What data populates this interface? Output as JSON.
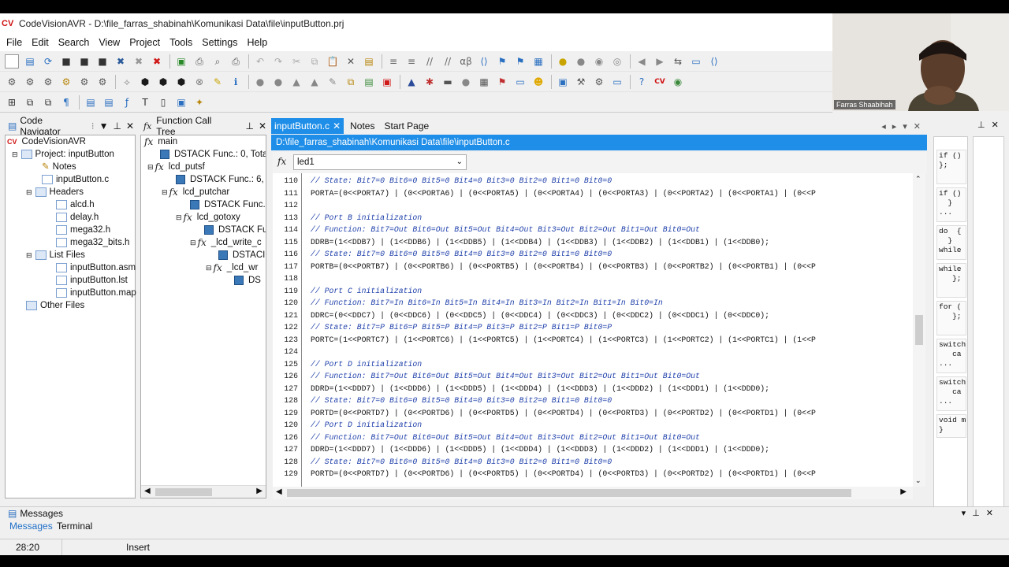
{
  "title": "CodeVisionAVR - D:\\file_farras_shabinah\\Komunikasi Data\\file\\inputButton.prj",
  "app_logo": "CV",
  "menu": [
    "File",
    "Edit",
    "Search",
    "View",
    "Project",
    "Tools",
    "Settings",
    "Help"
  ],
  "panels": {
    "navigator_title": "Code Navigator",
    "calltree_title": "Function Call Tree",
    "messages_title": "Messages",
    "messages_tabs": [
      "Messages",
      "Terminal"
    ]
  },
  "navigator": {
    "root": "CodeVisionAVR",
    "project": "Project: inputButton",
    "notes": "Notes",
    "c_file": "inputButton.c",
    "headers": "Headers",
    "header_files": [
      "alcd.h",
      "delay.h",
      "mega32.h",
      "mega32_bits.h"
    ],
    "list_files": "List Files",
    "list_items": [
      "inputButton.asm",
      "inputButton.lst",
      "inputButton.map"
    ],
    "other_files": "Other Files"
  },
  "calltree": {
    "main": "main",
    "dstack_main": "DSTACK Func.: 0, Tota",
    "lcd_putsf": "lcd_putsf",
    "dstack_putsf": "DSTACK Func.: 6, T",
    "lcd_putchar": "lcd_putchar",
    "dstack_putchar": "DSTACK Func.:",
    "lcd_gotoxy": "lcd_gotoxy",
    "dstack_gotoxy": "DSTACK Fu",
    "lcd_write": "_lcd_write_c",
    "dstack_write": "DSTACI",
    "lcd_wr": "_lcd_wr",
    "dstack_wr": "DS"
  },
  "editor": {
    "tabs": [
      "inputButton.c",
      "Notes",
      "Start Page"
    ],
    "path": "D:\\file_farras_shabinah\\Komunikasi Data\\file\\inputButton.c",
    "function_selector": "led1",
    "lines": [
      {
        "n": "110",
        "t": "// State: Bit7=0 Bit6=0 Bit5=0 Bit4=0 Bit3=0 Bit2=0 Bit1=0 Bit0=0",
        "c": true
      },
      {
        "n": "111",
        "t": "PORTA=(0<<PORTA7) | (0<<PORTA6) | (0<<PORTA5) | (0<<PORTA4) | (0<<PORTA3) | (0<<PORTA2) | (0<<PORTA1) | (0<<P",
        "c": false
      },
      {
        "n": "112",
        "t": "",
        "c": false
      },
      {
        "n": "113",
        "t": "// Port B initialization",
        "c": true
      },
      {
        "n": "114",
        "t": "// Function: Bit7=Out Bit6=Out Bit5=Out Bit4=Out Bit3=Out Bit2=Out Bit1=Out Bit0=Out",
        "c": true
      },
      {
        "n": "115",
        "t": "DDRB=(1<<DDB7) | (1<<DDB6) | (1<<DDB5) | (1<<DDB4) | (1<<DDB3) | (1<<DDB2) | (1<<DDB1) | (1<<DDB0);",
        "c": false
      },
      {
        "n": "116",
        "t": "// State: Bit7=0 Bit6=0 Bit5=0 Bit4=0 Bit3=0 Bit2=0 Bit1=0 Bit0=0",
        "c": true
      },
      {
        "n": "117",
        "t": "PORTB=(0<<PORTB7) | (0<<PORTB6) | (0<<PORTB5) | (0<<PORTB4) | (0<<PORTB3) | (0<<PORTB2) | (0<<PORTB1) | (0<<P",
        "c": false
      },
      {
        "n": "118",
        "t": "",
        "c": false
      },
      {
        "n": "119",
        "t": "// Port C initialization",
        "c": true
      },
      {
        "n": "120",
        "t": "// Function: Bit7=In Bit6=In Bit5=In Bit4=In Bit3=In Bit2=In Bit1=In Bit0=In",
        "c": true
      },
      {
        "n": "121",
        "t": "DDRC=(0<<DDC7) | (0<<DDC6) | (0<<DDC5) | (0<<DDC4) | (0<<DDC3) | (0<<DDC2) | (0<<DDC1) | (0<<DDC0);",
        "c": false
      },
      {
        "n": "122",
        "t": "// State: Bit7=P Bit6=P Bit5=P Bit4=P Bit3=P Bit2=P Bit1=P Bit0=P",
        "c": true
      },
      {
        "n": "123",
        "t": "PORTC=(1<<PORTC7) | (1<<PORTC6) | (1<<PORTC5) | (1<<PORTC4) | (1<<PORTC3) | (1<<PORTC2) | (1<<PORTC1) | (1<<P",
        "c": false
      },
      {
        "n": "124",
        "t": "",
        "c": false
      },
      {
        "n": "125",
        "t": "// Port D initialization",
        "c": true
      },
      {
        "n": "126",
        "t": "// Function: Bit7=Out Bit6=Out Bit5=Out Bit4=Out Bit3=Out Bit2=Out Bit1=Out Bit0=Out",
        "c": true
      },
      {
        "n": "127",
        "t": "DDRD=(1<<DDD7) | (1<<DDD6) | (1<<DDD5) | (1<<DDD4) | (1<<DDD3) | (1<<DDD2) | (1<<DDD1) | (1<<DDD0);",
        "c": false
      },
      {
        "n": "128",
        "t": "// State: Bit7=0 Bit6=0 Bit5=0 Bit4=0 Bit3=0 Bit2=0 Bit1=0 Bit0=0",
        "c": true
      },
      {
        "n": "129",
        "t": "PORTD=(0<<PORTD7) | (0<<PORTD6) | (0<<PORTD5) | (0<<PORTD4) | (0<<PORTD3) | (0<<PORTD2) | (0<<PORTD1) | (0<<P",
        "c": false
      },
      {
        "n": "120",
        "t": "// Port D initialization",
        "c": true
      },
      {
        "n": "126",
        "t": "// Function: Bit7=Out Bit6=Out Bit5=Out Bit4=Out Bit3=Out Bit2=Out Bit1=Out Bit0=Out",
        "c": true
      },
      {
        "n": "127",
        "t": "DDRD=(1<<DDD7) | (1<<DDD6) | (1<<DDD5) | (1<<DDD4) | (1<<DDD3) | (1<<DDD2) | (1<<DDD1) | (1<<DDD0);",
        "c": false
      },
      {
        "n": "128",
        "t": "// State: Bit7=0 Bit6=0 Bit5=0 Bit4=0 Bit3=0 Bit2=0 Bit1=0 Bit0=0",
        "c": true
      },
      {
        "n": "129",
        "t": "PORTD=(0<<PORTD7) | (0<<PORTD6) | (0<<PORTD5) | (0<<PORTD4) | (0<<PORTD3) | (0<<PORTD2) | (0<<PORTD1) | (0<<P",
        "c": false
      }
    ]
  },
  "snippets": [
    "if ()\n};",
    "if ()\n  }\n...",
    "do  {\n  }\nwhile",
    "while\n   };",
    "for (\n   };",
    "switch\n   ca\n...",
    "switch\n   ca\n...",
    "void m\n}"
  ],
  "webcam": {
    "name": "Farras Shaabihah"
  },
  "status": {
    "position": "28:20",
    "mode": "Insert"
  },
  "colors": {
    "accent_tab": "#1f8ee8",
    "comment": "#1e3faa",
    "logo": "#d01010"
  }
}
